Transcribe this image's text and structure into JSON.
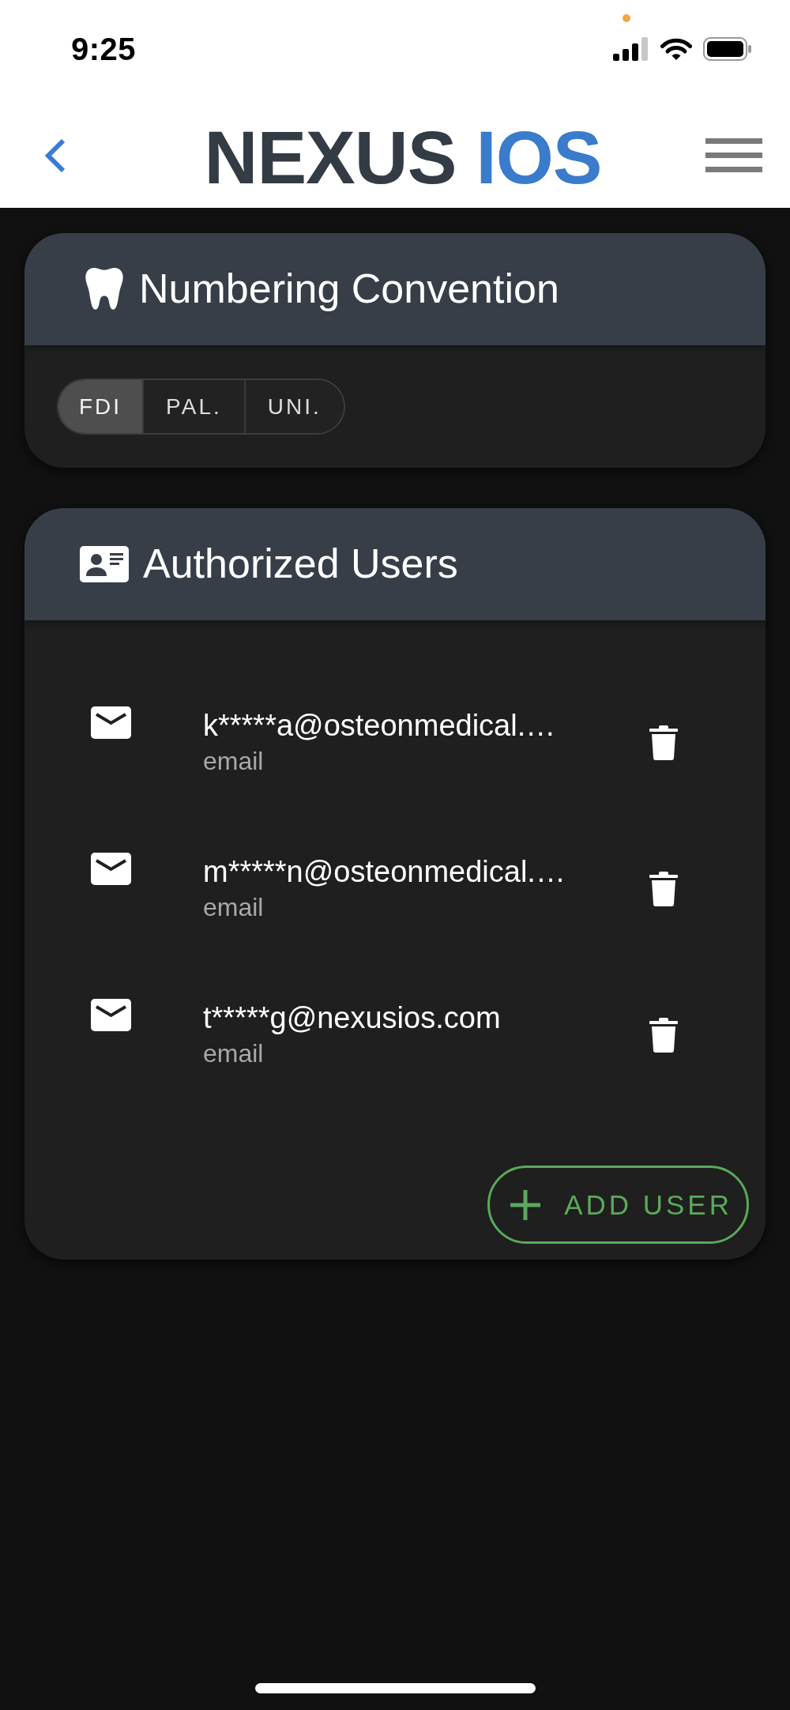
{
  "status_bar": {
    "time": "9:25"
  },
  "header": {
    "logo": {
      "brand": "NEXUS",
      "suffix": "IOS"
    }
  },
  "numbering_card": {
    "title": "Numbering Convention",
    "options": [
      {
        "label": "FDI",
        "selected": true
      },
      {
        "label": "PAL.",
        "selected": false
      },
      {
        "label": "UNI.",
        "selected": false
      }
    ]
  },
  "users_card": {
    "title": "Authorized Users",
    "users": [
      {
        "address": "k*****a@osteonmedical.…",
        "type": "email"
      },
      {
        "address": "m*****n@osteonmedical.…",
        "type": "email"
      },
      {
        "address": "t*****g@nexusios.com",
        "type": "email"
      }
    ],
    "add_button": {
      "label": "ADD USER"
    }
  }
}
